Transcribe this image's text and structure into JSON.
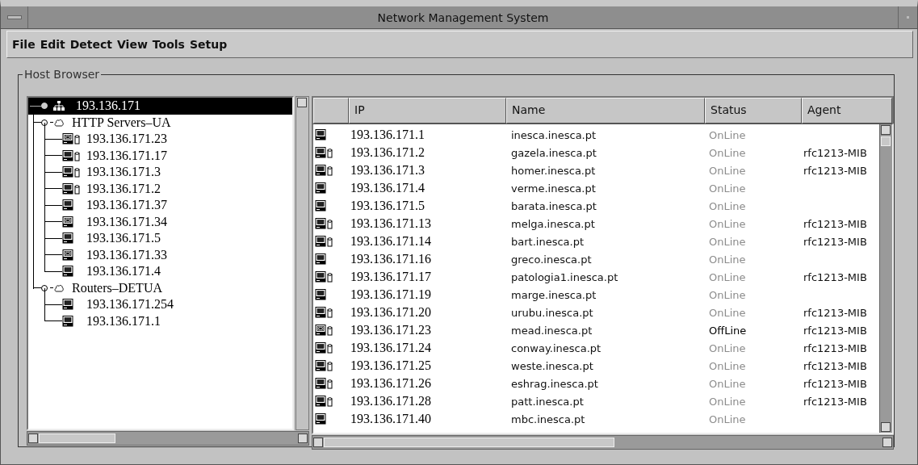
{
  "window": {
    "title": "Network Management System"
  },
  "menu": [
    "File",
    "Edit",
    "Detect",
    "View",
    "Tools",
    "Setup"
  ],
  "host_browser": {
    "title": "Host Browser",
    "tree": {
      "label": "193.136.171",
      "selected": true,
      "children": [
        {
          "label": "HTTP Servers–UA",
          "selected": false,
          "children": [
            {
              "label": "193.136.171.23",
              "agent": true,
              "down": true,
              "selected": false
            },
            {
              "label": "193.136.171.17",
              "agent": true,
              "down": false,
              "selected": false
            },
            {
              "label": "193.136.171.3",
              "agent": true,
              "down": false,
              "selected": false
            },
            {
              "label": "193.136.171.2",
              "agent": true,
              "down": false,
              "selected": false
            },
            {
              "label": "193.136.171.37",
              "agent": false,
              "down": false,
              "selected": false
            },
            {
              "label": "193.136.171.34",
              "agent": false,
              "down": true,
              "selected": false
            },
            {
              "label": "193.136.171.5",
              "agent": false,
              "down": false,
              "selected": false
            },
            {
              "label": "193.136.171.33",
              "agent": false,
              "down": true,
              "selected": false
            },
            {
              "label": "193.136.171.4",
              "agent": false,
              "down": false,
              "selected": false
            }
          ]
        },
        {
          "label": "Routers–DETUA",
          "selected": false,
          "children": [
            {
              "label": "193.136.171.254",
              "agent": false,
              "down": false,
              "selected": false
            },
            {
              "label": "193.136.171.1",
              "agent": false,
              "down": false,
              "selected": false
            }
          ]
        }
      ]
    },
    "table": {
      "columns": [
        "IP",
        "Name",
        "Status",
        "Agent"
      ],
      "rows": [
        {
          "agent_icon": false,
          "down": false,
          "ip": "193.136.171.1",
          "name": "inesca.inesca.pt",
          "status": "OnLine",
          "online": true
        },
        {
          "agent_icon": true,
          "down": false,
          "ip": "193.136.171.2",
          "name": "gazela.inesca.pt",
          "status": "OnLine",
          "online": true,
          "agent": "rfc1213-MIB"
        },
        {
          "agent_icon": true,
          "down": false,
          "ip": "193.136.171.3",
          "name": "homer.inesca.pt",
          "status": "OnLine",
          "online": true,
          "agent": "rfc1213-MIB"
        },
        {
          "agent_icon": false,
          "down": false,
          "ip": "193.136.171.4",
          "name": "verme.inesca.pt",
          "status": "OnLine",
          "online": true
        },
        {
          "agent_icon": false,
          "down": false,
          "ip": "193.136.171.5",
          "name": "barata.inesca.pt",
          "status": "OnLine",
          "online": true
        },
        {
          "agent_icon": true,
          "down": false,
          "ip": "193.136.171.13",
          "name": "melga.inesca.pt",
          "status": "OnLine",
          "online": true,
          "agent": "rfc1213-MIB"
        },
        {
          "agent_icon": true,
          "down": false,
          "ip": "193.136.171.14",
          "name": "bart.inesca.pt",
          "status": "OnLine",
          "online": true,
          "agent": "rfc1213-MIB"
        },
        {
          "agent_icon": false,
          "down": false,
          "ip": "193.136.171.16",
          "name": "greco.inesca.pt",
          "status": "OnLine",
          "online": true
        },
        {
          "agent_icon": true,
          "down": false,
          "ip": "193.136.171.17",
          "name": "patologia1.inesca.pt",
          "status": "OnLine",
          "online": true,
          "agent": "rfc1213-MIB"
        },
        {
          "agent_icon": false,
          "down": false,
          "ip": "193.136.171.19",
          "name": "marge.inesca.pt",
          "status": "OnLine",
          "online": true
        },
        {
          "agent_icon": true,
          "down": false,
          "ip": "193.136.171.20",
          "name": "urubu.inesca.pt",
          "status": "OnLine",
          "online": true,
          "agent": "rfc1213-MIB"
        },
        {
          "agent_icon": true,
          "down": true,
          "ip": "193.136.171.23",
          "name": "mead.inesca.pt",
          "status": "OffLine",
          "online": false,
          "agent": "rfc1213-MIB"
        },
        {
          "agent_icon": true,
          "down": false,
          "ip": "193.136.171.24",
          "name": "conway.inesca.pt",
          "status": "OnLine",
          "online": true,
          "agent": "rfc1213-MIB"
        },
        {
          "agent_icon": true,
          "down": false,
          "ip": "193.136.171.25",
          "name": "weste.inesca.pt",
          "status": "OnLine",
          "online": true,
          "agent": "rfc1213-MIB"
        },
        {
          "agent_icon": true,
          "down": false,
          "ip": "193.136.171.26",
          "name": "eshrag.inesca.pt",
          "status": "OnLine",
          "online": true,
          "agent": "rfc1213-MIB"
        },
        {
          "agent_icon": true,
          "down": false,
          "ip": "193.136.171.28",
          "name": "patt.inesca.pt",
          "status": "OnLine",
          "online": true,
          "agent": "rfc1213-MIB"
        },
        {
          "agent_icon": false,
          "down": false,
          "ip": "193.136.171.40",
          "name": "mbc.inesca.pt",
          "status": "OnLine",
          "online": true
        }
      ]
    }
  }
}
